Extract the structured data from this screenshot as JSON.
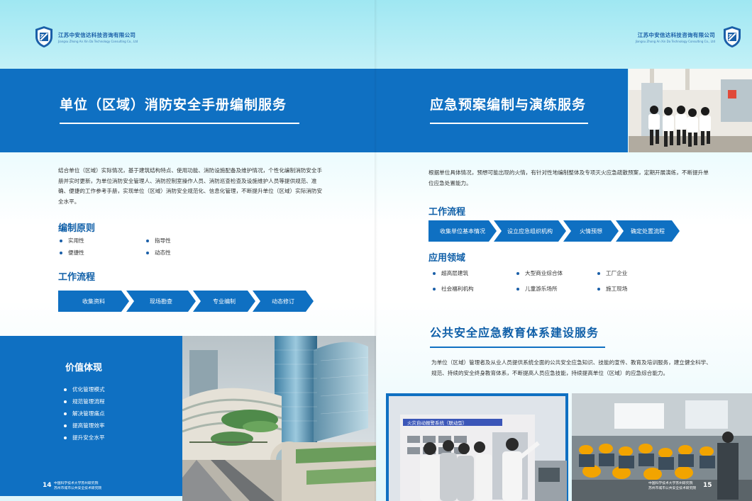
{
  "company": {
    "name_cn": "江苏中安信达科技咨询有限公司",
    "name_en": "Jiangsu Zhong An Xin Da Technology Consulting Co., Ltd"
  },
  "left": {
    "banner_title": "单位（区域）消防安全手册编制服务",
    "intro": "结合单位（区域）实际情况，基于建筑结构特点、使用功能、消防设施配备及维护情况，个性化编制消防安全手册并实时更新，为单位消防安全管理人、消防控制室操作人员、消防巡查检查及设施维护人员等提供规范、准确、便捷的工作参考手册，实现单位（区域）消防安全规范化、信息化管理，不断提升单位（区域）实际消防安全水平。",
    "principles_title": "编制原则",
    "principles": [
      "实用性",
      "指导性",
      "便捷性",
      "动态性"
    ],
    "workflow_title": "工作流程",
    "workflow": [
      "收集资料",
      "现场勘查",
      "专业编制",
      "动态修订"
    ],
    "value_title": "价值体现",
    "values": [
      "优化管理模式",
      "规范管理流程",
      "解决管理痛点",
      "提高管理效率",
      "提升安全水平"
    ],
    "page_number": "14",
    "footer_line1": "中国科学技术大学苏州研究院",
    "footer_line2": "苏州市城市公共安全技术研究院"
  },
  "right": {
    "banner_title": "应急预案编制与演练服务",
    "intro": "根据单位具体情况，预想可能出现的火情，有针对性地编制整体及专项灭火应急疏散预案，定期开展演练，不断提升单位应急处置能力。",
    "workflow_title": "工作流程",
    "workflow": [
      "收集单位基本情况",
      "设立应急组织机构",
      "火情预想",
      "确定处置流程"
    ],
    "application_title": "应用领域",
    "applications": [
      "超高层建筑",
      "大型商业综合体",
      "工厂企业",
      "社会福利机构",
      "儿童游乐场所",
      "施工现场"
    ],
    "edu_title": "公共安全应急教育体系建设服务",
    "edu_text": "为单位（区域）管理者及从业人员提供系统全面的公共安全应急知识、技能的宣传、教育及培训服务，建立健全科学、规范、持续的安全终身教育体系，不断提高人员应急技能，持续提高单位（区域）的应急综合能力。",
    "screen_sign": "火灾自动报警系统（联动型）",
    "page_number": "15",
    "footer_line1": "中国科学技术大学苏州研究院",
    "footer_line2": "苏州市城市公共安全技术研究院"
  },
  "colors": {
    "brand_blue": "#0f70c2",
    "title_blue": "#0f5fa8",
    "sky": "#9fe7f2"
  }
}
